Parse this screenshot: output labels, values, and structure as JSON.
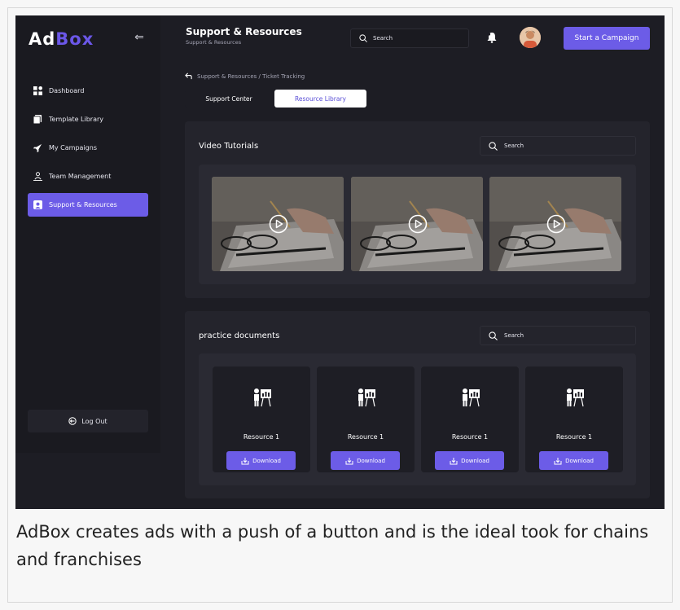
{
  "app": {
    "logo_main": "Ad",
    "logo_accent": "Box",
    "accent_color": "#6c5ce7"
  },
  "sidebar": {
    "items": [
      {
        "label": "Dashboard",
        "icon": "dashboard-icon"
      },
      {
        "label": "Template Library",
        "icon": "template-icon"
      },
      {
        "label": "My Campaigns",
        "icon": "rocket-icon"
      },
      {
        "label": "Team Management",
        "icon": "team-icon"
      },
      {
        "label": "Support & Resources",
        "icon": "support-icon",
        "active": true
      }
    ],
    "logout_label": "Log Out"
  },
  "header": {
    "title": "Support & Resources",
    "subtitle": "Support & Resources",
    "search_placeholder": "Search",
    "cta_label": "Start a Campaign"
  },
  "breadcrumb": "Support & Resources / Ticket Tracking",
  "tabs": [
    {
      "label": "Support Center",
      "active": false
    },
    {
      "label": "Resource Library",
      "active": true
    }
  ],
  "video_section": {
    "title": "Video Tutorials",
    "search_placeholder": "Search",
    "videos": [
      {
        "icon": "play-icon"
      },
      {
        "icon": "play-icon"
      },
      {
        "icon": "play-icon"
      }
    ]
  },
  "docs_section": {
    "title": "practice documents",
    "search_placeholder": "Search",
    "cards": [
      {
        "label": "Resource 1",
        "button": "Download"
      },
      {
        "label": "Resource 1",
        "button": "Download"
      },
      {
        "label": "Resource 1",
        "button": "Download"
      },
      {
        "label": "Resource 1",
        "button": "Download"
      }
    ]
  },
  "caption": "AdBox creates ads with a push of a button and is the ideal took for chains and franchises"
}
